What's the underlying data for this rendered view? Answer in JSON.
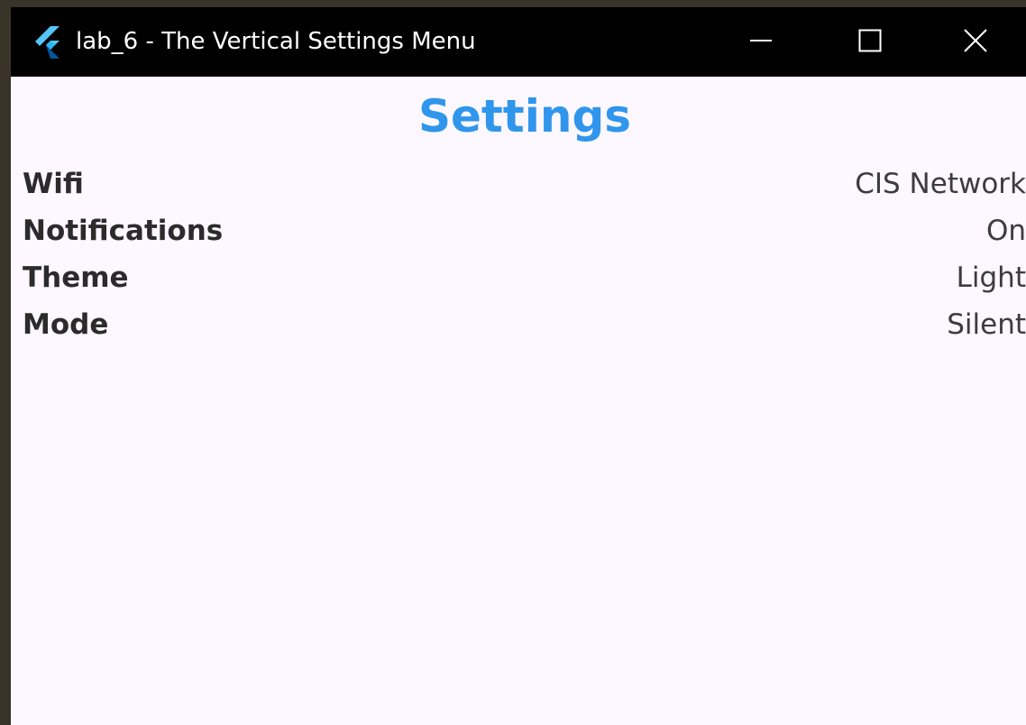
{
  "window": {
    "title": "lab_6 - The Vertical Settings Menu",
    "app_icon": "flutter-logo-icon",
    "controls": {
      "minimize": "minimize-icon",
      "maximize": "maximize-icon",
      "close": "close-icon"
    }
  },
  "page": {
    "title": "Settings"
  },
  "settings": [
    {
      "label": "Wifi",
      "value": "CIS Network"
    },
    {
      "label": "Notifications",
      "value": "On"
    },
    {
      "label": "Theme",
      "value": "Light"
    },
    {
      "label": "Mode",
      "value": "Silent"
    }
  ],
  "colors": {
    "titlebar": "#000000",
    "background": "#fdf7ff",
    "accent": "#2f96ec",
    "label": "#2b2b2b",
    "value": "#3c3c3c"
  }
}
